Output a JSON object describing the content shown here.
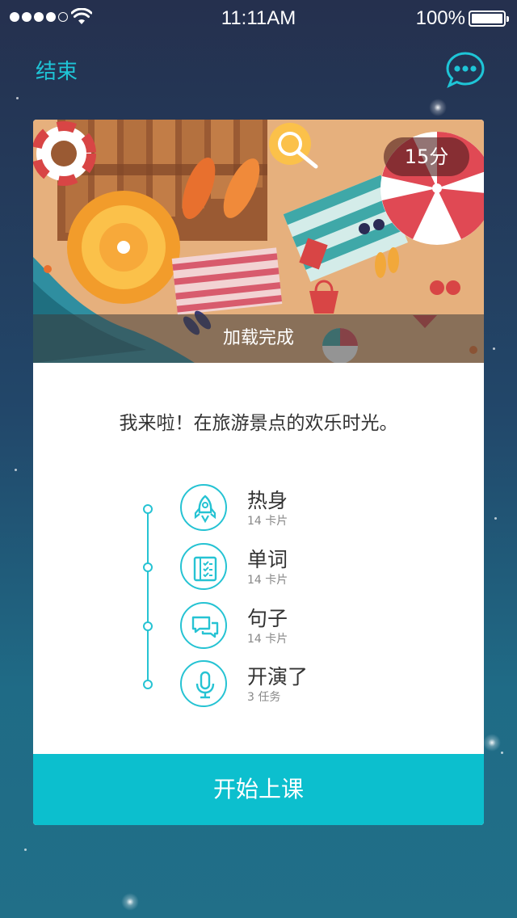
{
  "status_bar": {
    "time": "11:11AM",
    "battery": "100%",
    "signal_bars_filled": 4,
    "signal_bars_total": 5
  },
  "header": {
    "end_label": "结束",
    "more_icon": "chat-more-icon"
  },
  "lesson": {
    "duration": "15分",
    "loading_status": "加载完成",
    "headline": "我来啦！在旅游景点的欢乐时光。",
    "steps": [
      {
        "title": "热身",
        "count": "14",
        "unit": "卡片",
        "icon": "rocket-icon"
      },
      {
        "title": "单词",
        "count": "14",
        "unit": "卡片",
        "icon": "notebook-checklist-icon"
      },
      {
        "title": "句子",
        "count": "14",
        "unit": "卡片",
        "icon": "chat-bubbles-icon"
      },
      {
        "title": "开演了",
        "count": "3",
        "unit": "任务",
        "icon": "microphone-icon"
      }
    ],
    "start_label": "开始上课"
  },
  "colors": {
    "accent": "#0cbfce",
    "accent_text": "#1ec5d7",
    "background_top": "#25304e",
    "background_bottom": "#216f88"
  }
}
